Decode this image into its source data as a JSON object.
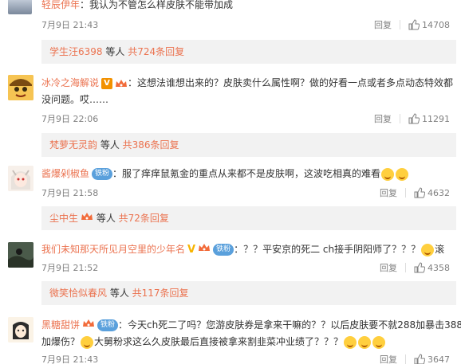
{
  "comments": [
    {
      "user": "轻辰伊年",
      "text": "：我认为不管怎么样皮肤不能带加成",
      "date": "7月9日 21:43",
      "reply": "回复",
      "likes": "14708",
      "reply_summary": {
        "user": "学生汪6398",
        "mid": " 等人 ",
        "more": "共724条回复"
      }
    },
    {
      "user": "冰冷之海解说",
      "badges": [
        "V",
        "vip"
      ],
      "text_line1": "：这想法谁想出来的？皮肤卖什么属性啊？做的好看一点或者多点动态特效都",
      "text_line2": "没问题。哎……",
      "date": "7月9日 22:06",
      "reply": "回复",
      "likes": "11291",
      "reply_summary": {
        "user": "梵萝无灵韵",
        "mid": " 等人 ",
        "more": "共386条回复"
      }
    },
    {
      "user": "酱爆剁椒鱼",
      "fan_badge": "铁粉",
      "text": "：服了痒痒鼠氪金的重点从来都不是皮肤啊，这波吃相真的难看",
      "date": "7月9日 21:58",
      "reply": "回复",
      "likes": "4632",
      "reply_summary": {
        "user": "尘中生",
        "mid": " 等人 ",
        "more": "共72条回复"
      }
    },
    {
      "user": "我们未知那天所见月空里的少年名",
      "fan_badge": "铁粉",
      "text": "：？？平安京的死二 ch接手阴阳师了？？？",
      "text_tail": "滚",
      "date": "7月9日 21:52",
      "reply": "回复",
      "likes": "4358",
      "reply_summary": {
        "user": "微笑恰似春风",
        "mid": " 等人 ",
        "more": "共117条回复"
      }
    },
    {
      "user": "黑糖甜饼",
      "fan_badge": "铁粉",
      "text_line1": "：今天ch死二了吗？您游皮肤券是拿来干嘛的？？以后皮肤要不就288加暴击388",
      "text_line2a": "加爆伤？",
      "text_line2b": "大舅粉求这么久皮肤最后直接被拿来割韭菜冲业绩了？？？",
      "date": "7月9日 21:43",
      "reply": "回复",
      "likes": "3647"
    }
  ],
  "icons": {
    "thumb": "thumbs-up-icon",
    "emoji": "laugh-emoji-icon"
  },
  "colors": {
    "username": "#eb7350",
    "meta": "#808080",
    "reply_bg": "#f2f2f2"
  }
}
